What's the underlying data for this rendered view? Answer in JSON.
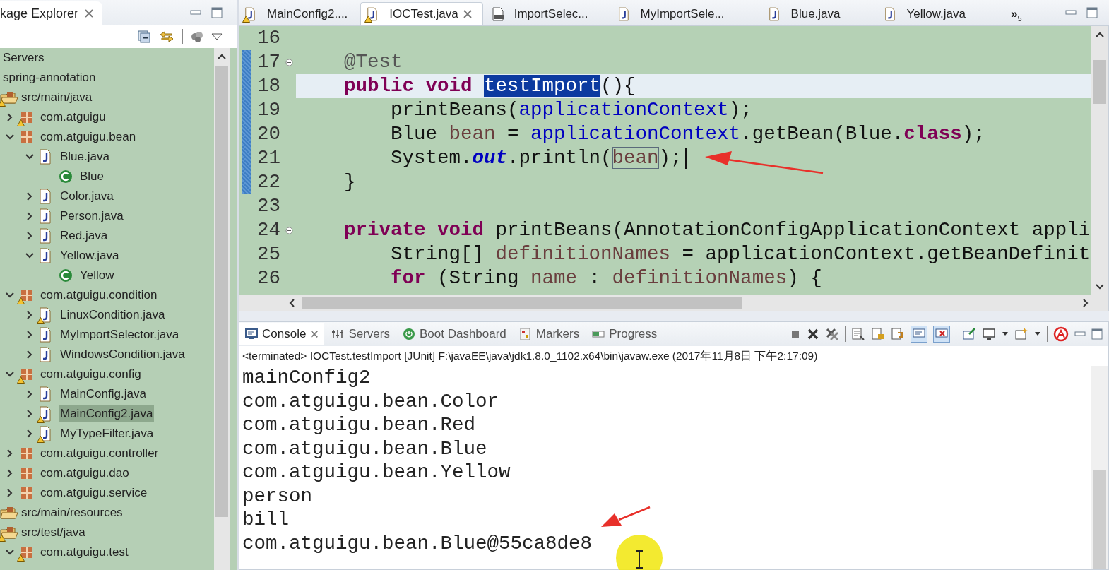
{
  "explorer": {
    "tab": {
      "label": "kage Explorer",
      "selected": true
    },
    "tree": [
      {
        "label": "Servers"
      },
      {
        "label": "spring-annotation",
        "children": [
          {
            "label": "src/main/java",
            "kind": "source-folder",
            "warning": true,
            "children": [
              {
                "label": "com.atguigu",
                "kind": "package",
                "expanded": false,
                "warning": true
              },
              {
                "label": "com.atguigu.bean",
                "kind": "package",
                "expanded": true,
                "warning": false,
                "children": [
                  {
                    "label": "Blue.java",
                    "kind": "file",
                    "expanded": true,
                    "warning": false,
                    "selected": false,
                    "children": [
                      {
                        "label": "Blue",
                        "kind": "class"
                      }
                    ]
                  },
                  {
                    "label": "Color.java",
                    "kind": "file",
                    "expanded": false,
                    "warning": false,
                    "selected": false
                  },
                  {
                    "label": "Person.java",
                    "kind": "file",
                    "expanded": false,
                    "warning": false,
                    "selected": false
                  },
                  {
                    "label": "Red.java",
                    "kind": "file",
                    "expanded": false,
                    "warning": false,
                    "selected": false
                  },
                  {
                    "label": "Yellow.java",
                    "kind": "file",
                    "expanded": true,
                    "warning": false,
                    "selected": false,
                    "children": [
                      {
                        "label": "Yellow",
                        "kind": "class"
                      }
                    ]
                  }
                ]
              },
              {
                "label": "com.atguigu.condition",
                "kind": "package",
                "expanded": true,
                "warning": true,
                "children": [
                  {
                    "label": "LinuxCondition.java",
                    "kind": "file",
                    "expanded": false,
                    "warning": true,
                    "selected": false
                  },
                  {
                    "label": "MyImportSelector.java",
                    "kind": "file",
                    "expanded": false,
                    "warning": false,
                    "selected": false
                  },
                  {
                    "label": "WindowsCondition.java",
                    "kind": "file",
                    "expanded": false,
                    "warning": false,
                    "selected": false
                  }
                ]
              },
              {
                "label": "com.atguigu.config",
                "kind": "package",
                "expanded": true,
                "warning": true,
                "children": [
                  {
                    "label": "MainConfig.java",
                    "kind": "file",
                    "expanded": false,
                    "warning": false,
                    "selected": false
                  },
                  {
                    "label": "MainConfig2.java",
                    "kind": "file",
                    "expanded": false,
                    "warning": true,
                    "selected": true
                  },
                  {
                    "label": "MyTypeFilter.java",
                    "kind": "file",
                    "expanded": false,
                    "warning": true,
                    "selected": false
                  }
                ]
              },
              {
                "label": "com.atguigu.controller",
                "kind": "package",
                "expanded": false,
                "warning": false
              },
              {
                "label": "com.atguigu.dao",
                "kind": "package",
                "expanded": false,
                "warning": false
              },
              {
                "label": "com.atguigu.service",
                "kind": "package",
                "expanded": false,
                "warning": false
              }
            ]
          },
          {
            "label": "src/main/resources",
            "kind": "source-folder",
            "warning": false
          },
          {
            "label": "src/test/java",
            "kind": "source-folder",
            "warning": true,
            "children": [
              {
                "label": "com.atguigu.test",
                "kind": "package",
                "expanded": true,
                "warning": true
              }
            ]
          }
        ]
      }
    ]
  },
  "editor": {
    "tabs": [
      {
        "label": "MainConfig2....",
        "kind": "java",
        "warning": true,
        "selected": false
      },
      {
        "label": "IOCTest.java",
        "kind": "java",
        "warning": true,
        "selected": true
      },
      {
        "label": "ImportSelec...",
        "kind": "classfile",
        "warning": false,
        "selected": false
      },
      {
        "label": "MyImportSele...",
        "kind": "java",
        "warning": false,
        "selected": false
      },
      {
        "label": "Blue.java",
        "kind": "java",
        "warning": false,
        "selected": false
      },
      {
        "label": "Yellow.java",
        "kind": "java",
        "warning": false,
        "selected": false
      }
    ],
    "overflow": {
      "label": "»",
      "count": "5"
    },
    "lines": [
      {
        "number": "16",
        "fold": false,
        "current": false,
        "in_range": false,
        "caret": false
      },
      {
        "number": "17",
        "fold": true,
        "current": false,
        "in_range": true,
        "caret": false,
        "segments": [
          {
            "text": "    @Test",
            "kind": "annotation"
          }
        ]
      },
      {
        "number": "18",
        "fold": false,
        "current": true,
        "in_range": true,
        "caret": false,
        "segments": [
          {
            "text": "    public void ",
            "kind": "keyword"
          },
          {
            "text": "testImport",
            "kind": "selection"
          },
          {
            "text": "(){",
            "kind": "plain"
          }
        ]
      },
      {
        "number": "19",
        "fold": false,
        "current": false,
        "in_range": true,
        "caret": false,
        "segments": [
          {
            "text": "        printBeans(",
            "kind": "plain"
          },
          {
            "text": "applicationContext",
            "kind": "field"
          },
          {
            "text": ");",
            "kind": "plain"
          }
        ]
      },
      {
        "number": "20",
        "fold": false,
        "current": false,
        "in_range": true,
        "caret": false,
        "segments": [
          {
            "text": "        Blue ",
            "kind": "plain"
          },
          {
            "text": "bean",
            "kind": "local"
          },
          {
            "text": " = ",
            "kind": "plain"
          },
          {
            "text": "applicationContext",
            "kind": "field"
          },
          {
            "text": ".getBean(Blue.",
            "kind": "plain"
          },
          {
            "text": "class",
            "kind": "keyword"
          },
          {
            "text": ");",
            "kind": "plain"
          }
        ]
      },
      {
        "number": "21",
        "fold": false,
        "current": false,
        "in_range": true,
        "caret": true,
        "segments": [
          {
            "text": "        System.",
            "kind": "plain"
          },
          {
            "text": "out",
            "kind": "static"
          },
          {
            "text": ".println(",
            "kind": "plain"
          },
          {
            "text": "bean",
            "kind": "occurrence"
          },
          {
            "text": ");",
            "kind": "plain"
          }
        ]
      },
      {
        "number": "22",
        "fold": false,
        "current": false,
        "in_range": true,
        "caret": false,
        "segments": [
          {
            "text": "    }",
            "kind": "plain"
          }
        ]
      },
      {
        "number": "23",
        "fold": false,
        "current": false,
        "in_range": false,
        "caret": false
      },
      {
        "number": "24",
        "fold": true,
        "current": false,
        "in_range": false,
        "caret": false,
        "segments": [
          {
            "text": "    private void ",
            "kind": "keyword"
          },
          {
            "text": "printBeans(AnnotationConfigApplicationContext appli",
            "kind": "plain"
          }
        ]
      },
      {
        "number": "25",
        "fold": false,
        "current": false,
        "in_range": false,
        "caret": false,
        "segments": [
          {
            "text": "        String[] ",
            "kind": "plain"
          },
          {
            "text": "definitionNames",
            "kind": "local"
          },
          {
            "text": " = applicationContext.getBeanDefinit",
            "kind": "plain"
          }
        ]
      },
      {
        "number": "26",
        "fold": false,
        "current": false,
        "in_range": false,
        "caret": false,
        "segments": [
          {
            "text": "        for",
            "kind": "keyword"
          },
          {
            "text": " (String ",
            "kind": "plain"
          },
          {
            "text": "name",
            "kind": "local"
          },
          {
            "text": " : ",
            "kind": "plain"
          },
          {
            "text": "definitionNames",
            "kind": "local"
          },
          {
            "text": ") {",
            "kind": "plain"
          }
        ]
      }
    ]
  },
  "console": {
    "tabs": [
      {
        "label": "Console",
        "kind": "console",
        "selected": true
      },
      {
        "label": "Servers",
        "kind": "servers",
        "selected": false
      },
      {
        "label": "Boot Dashboard",
        "kind": "boot",
        "selected": false
      },
      {
        "label": "Markers",
        "kind": "markers",
        "selected": false
      },
      {
        "label": "Progress",
        "kind": "progress",
        "selected": false
      }
    ],
    "header": "<terminated> IOCTest.testImport [JUnit] F:\\javaEE\\java\\jdk1.8.0_1102.x64\\bin\\javaw.exe (2017年11月8日 下午2:17:09)",
    "output": [
      "mainConfig2",
      "com.atguigu.bean.Color",
      "com.atguigu.bean.Red",
      "com.atguigu.bean.Blue",
      "com.atguigu.bean.Yellow",
      "person",
      "bill",
      "com.atguigu.bean.Blue@55ca8de8"
    ]
  }
}
